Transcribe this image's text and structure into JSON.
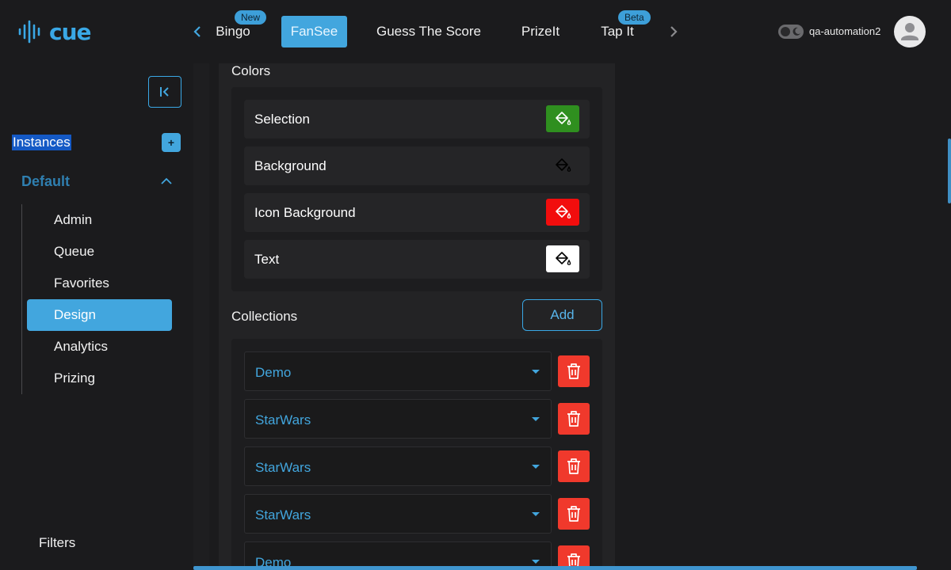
{
  "brand": {
    "logo_text": "cue",
    "color": "#3aa8e6"
  },
  "nav": {
    "tabs": [
      {
        "label": "Bingo",
        "badge": "New",
        "active": false
      },
      {
        "label": "FanSee",
        "badge": "",
        "active": true
      },
      {
        "label": "Guess The Score",
        "badge": "",
        "active": false
      },
      {
        "label": "PrizeIt",
        "badge": "",
        "active": false
      },
      {
        "label": "Tap It",
        "badge": "Beta",
        "active": false
      }
    ],
    "prev_icon": "chevron-left-icon",
    "next_icon": "chevron-right-icon"
  },
  "user": {
    "name": "qa-automation2",
    "avatar_icon": "user-icon",
    "theme_toggle_icon": "moon-icon"
  },
  "sidebar": {
    "collapse_icon": "collapse-sidebar-icon",
    "instances_label": "Instances",
    "add_instance_label": "+",
    "default_label": "Default",
    "items": [
      {
        "label": "Admin",
        "active": false
      },
      {
        "label": "Queue",
        "active": false
      },
      {
        "label": "Favorites",
        "active": false
      },
      {
        "label": "Design",
        "active": true
      },
      {
        "label": "Analytics",
        "active": false
      },
      {
        "label": "Prizing",
        "active": false
      }
    ],
    "filters_label": "Filters"
  },
  "colors_section": {
    "title": "Colors",
    "rows": [
      {
        "label": "Selection",
        "color": "#2f8f1f",
        "icon": "paint-bucket-icon"
      },
      {
        "label": "Background",
        "color": "transparent",
        "icon": "paint-bucket-icon"
      },
      {
        "label": "Icon Background",
        "color": "#f20d0d",
        "icon": "paint-bucket-icon"
      },
      {
        "label": "Text",
        "color": "#ffffff",
        "icon": "paint-bucket-icon"
      }
    ]
  },
  "collections_section": {
    "title": "Collections",
    "add_label": "Add",
    "rows": [
      {
        "value": "Demo"
      },
      {
        "value": "StarWars"
      },
      {
        "value": "StarWars"
      },
      {
        "value": "StarWars"
      },
      {
        "value": "Demo"
      }
    ],
    "delete_icon": "trash-icon"
  },
  "theme": {
    "accent": "#42a6de",
    "danger": "#f0392c",
    "background": "#1b1b1d"
  }
}
